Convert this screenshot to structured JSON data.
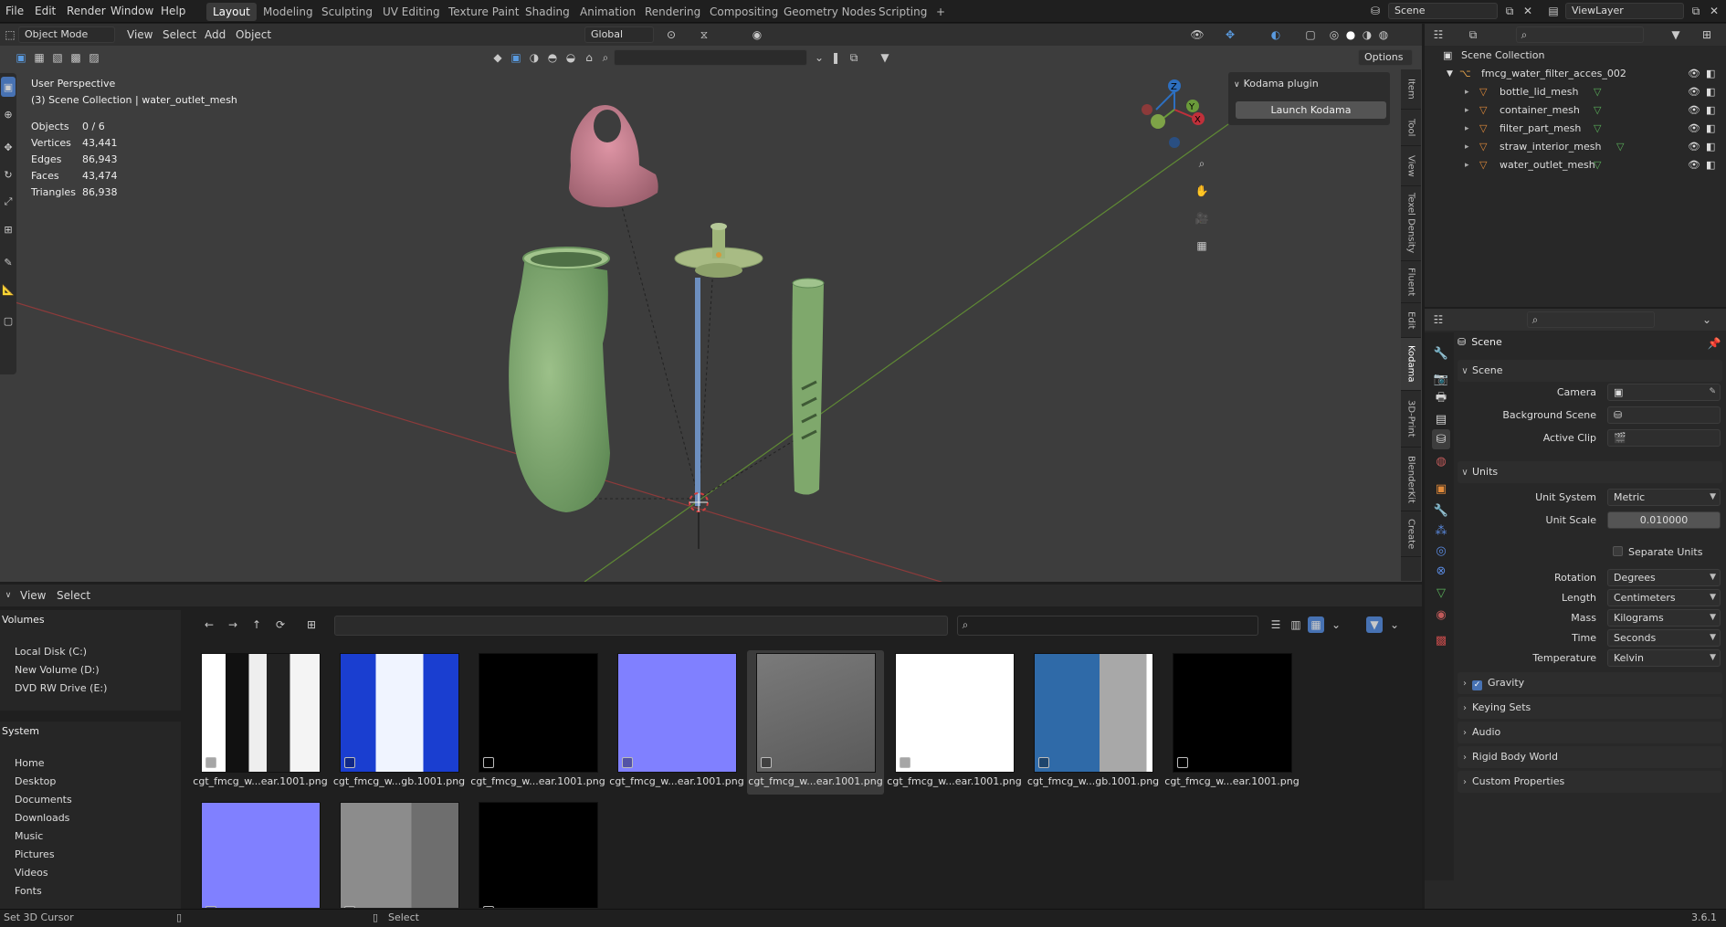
{
  "menubar": {
    "items": [
      "File",
      "Edit",
      "Render",
      "Window",
      "Help"
    ],
    "workspaces": [
      "Layout",
      "Modeling",
      "Sculpting",
      "UV Editing",
      "Texture Paint",
      "Shading",
      "Animation",
      "Rendering",
      "Compositing",
      "Geometry Nodes",
      "Scripting"
    ],
    "active_workspace": "Layout",
    "add_workspace": "+",
    "scene_name": "Scene",
    "view_layer": "ViewLayer"
  },
  "viewport_header": {
    "mode": "Object Mode",
    "menus": [
      "View",
      "Select",
      "Add",
      "Object"
    ],
    "transform_orientation": "Global",
    "options_label": "Options"
  },
  "viewport": {
    "perspective": "User Perspective",
    "collection_info": "(3) Scene Collection | water_outlet_mesh",
    "stats": [
      {
        "label": "Objects",
        "value": "0 / 6"
      },
      {
        "label": "Vertices",
        "value": "43,441"
      },
      {
        "label": "Edges",
        "value": "86,943"
      },
      {
        "label": "Faces",
        "value": "43,474"
      },
      {
        "label": "Triangles",
        "value": "86,938"
      }
    ],
    "gizmo_axes": [
      "Z",
      "Y",
      "X"
    ],
    "colors": {
      "bottle": "#7faa6e",
      "lid": "#c9798c",
      "straw": "#5b7fb0",
      "filter": "#9fb57a",
      "x_axis": "#a13a3a",
      "y_axis": "#6a9a3a"
    }
  },
  "kodama_panel": {
    "title": "Kodama plugin",
    "button": "Launch Kodama"
  },
  "sidebar_tabs": [
    "Item",
    "Tool",
    "View",
    "Texel Density",
    "Fluent",
    "Edit",
    "Kodama",
    "3D-Print",
    "BlenderKit",
    "Create"
  ],
  "active_sidebar_tab": "Kodama",
  "file_browser": {
    "menus": [
      "View",
      "Select"
    ],
    "volumes_title": "Volumes",
    "volumes": [
      "Local Disk (C:)",
      "New Volume (D:)",
      "DVD RW Drive (E:)"
    ],
    "system_title": "System",
    "system": [
      "Home",
      "Desktop",
      "Documents",
      "Downloads",
      "Music",
      "Pictures",
      "Videos",
      "Fonts"
    ],
    "thumbnails": [
      {
        "label": "cgt_fmcg_w...ear.1001.png",
        "kind": "bw"
      },
      {
        "label": "cgt_fmcg_w...gb.1001.png",
        "kind": "blue"
      },
      {
        "label": "cgt_fmcg_w...ear.1001.png",
        "kind": "black"
      },
      {
        "label": "cgt_fmcg_w...ear.1001.png",
        "kind": "normal"
      },
      {
        "label": "cgt_fmcg_w...ear.1001.png",
        "kind": "gray"
      },
      {
        "label": "cgt_fmcg_w...ear.1001.png",
        "kind": "white"
      },
      {
        "label": "cgt_fmcg_w...gb.1001.png",
        "kind": "bluegray"
      },
      {
        "label": "cgt_fmcg_w...ear.1001.png",
        "kind": "black"
      },
      {
        "label": "",
        "kind": "normal"
      },
      {
        "label": "",
        "kind": "lightgray"
      },
      {
        "label": "",
        "kind": "black"
      }
    ]
  },
  "outliner": {
    "root": "Scene Collection",
    "collection": "fmcg_water_filter_acces_002",
    "objects": [
      "bottle_lid_mesh",
      "container_mesh",
      "filter_part_mesh",
      "straw_interior_mesh",
      "water_outlet_mesh"
    ]
  },
  "properties": {
    "context": "Scene",
    "scene_section": "Scene",
    "camera_label": "Camera",
    "background_label": "Background Scene",
    "active_clip_label": "Active Clip",
    "units_section": "Units",
    "units": [
      {
        "label": "Unit System",
        "value": "Metric"
      },
      {
        "label": "Unit Scale",
        "value": "0.010000"
      },
      {
        "label": "Rotation",
        "value": "Degrees"
      },
      {
        "label": "Length",
        "value": "Centimeters"
      },
      {
        "label": "Mass",
        "value": "Kilograms"
      },
      {
        "label": "Time",
        "value": "Seconds"
      },
      {
        "label": "Temperature",
        "value": "Kelvin"
      }
    ],
    "separate_units": "Separate Units",
    "collapsed_sections": [
      "Gravity",
      "Keying Sets",
      "Audio",
      "Rigid Body World",
      "Custom Properties"
    ],
    "gravity_checked": true
  },
  "statusbar": {
    "left": "Set 3D Cursor",
    "middle": "Select",
    "version": "3.6.1"
  }
}
